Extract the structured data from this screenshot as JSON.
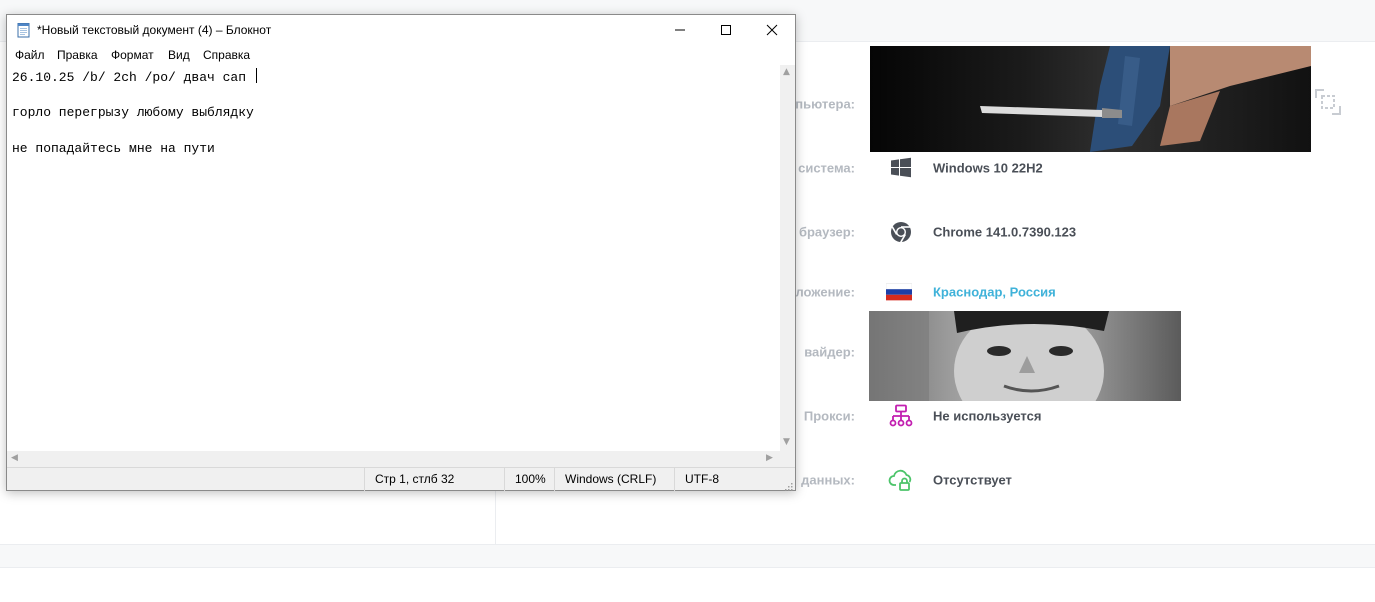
{
  "page": {
    "rows": [
      {
        "label": "пьютера:",
        "icon": "photo",
        "value": ""
      },
      {
        "label": "система:",
        "icon": "windows-icon",
        "value": "Windows 10 22H2"
      },
      {
        "label": "браузер:",
        "icon": "chrome-icon",
        "value": "Chrome 141.0.7390.123"
      },
      {
        "label": "ложение:",
        "icon": "russia-flag-icon",
        "value": "Краснодар, Россия"
      },
      {
        "label": "вайдер:",
        "icon": "photo",
        "value": ""
      },
      {
        "label": "Прокси:",
        "icon": "network-icon",
        "value": "Не используется"
      },
      {
        "label": "данных:",
        "icon": "cloud-lock-icon",
        "value": "Отсутствует"
      }
    ],
    "colors": {
      "label": "#b4b9c0",
      "value": "#4a4f57",
      "link": "#3fb2d9",
      "proxy_icon": "#c21fb0",
      "cloud_icon": "#4cc46a"
    }
  },
  "notepad": {
    "title": "*Новый текстовый документ (4) – Блокнот",
    "menu": [
      "Файл",
      "Правка",
      "Формат",
      "Вид",
      "Справка"
    ],
    "lines": [
      "26.10.25 /b/ 2ch /po/ двач сап ",
      "",
      "горло перегрызу любому выблядку",
      "",
      "не попадайтесь мне на пути"
    ],
    "status": {
      "position": "Стр 1, стлб 32",
      "zoom": "100%",
      "line_ending": "Windows (CRLF)",
      "encoding": "UTF-8"
    }
  }
}
